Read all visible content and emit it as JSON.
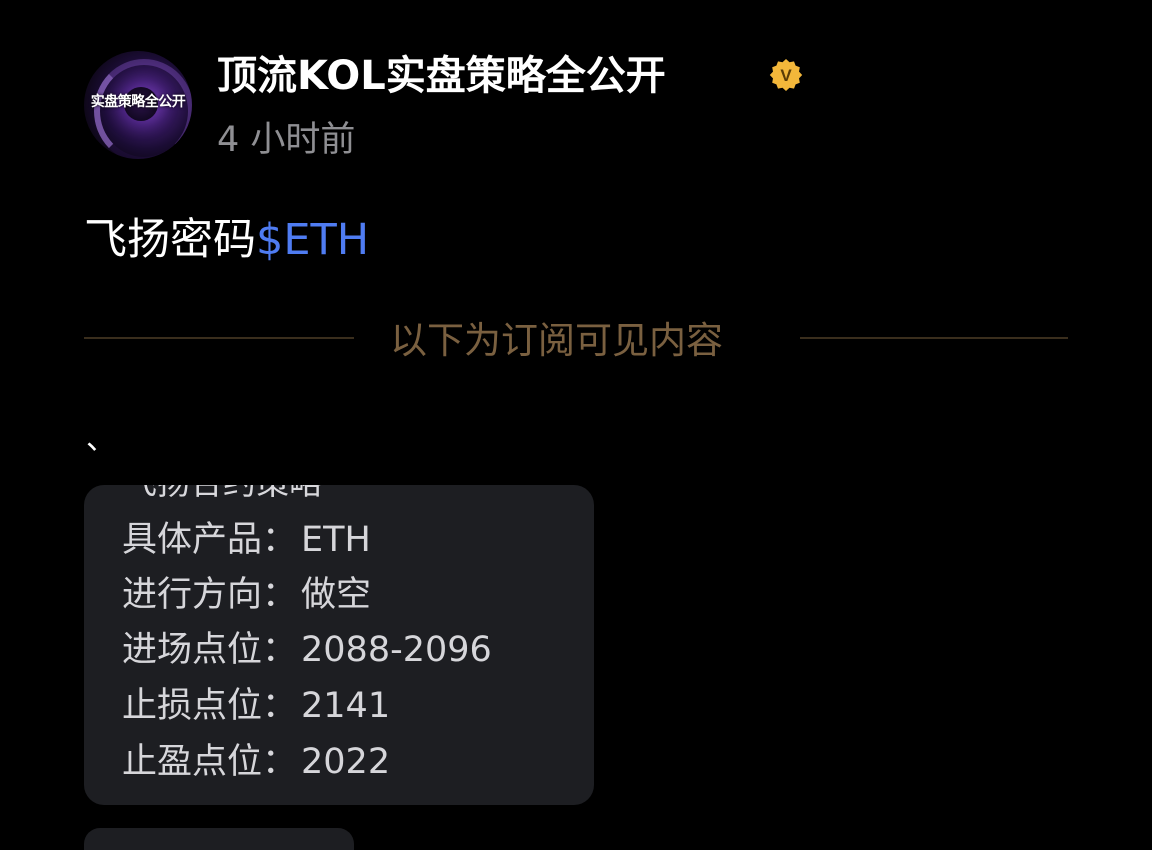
{
  "author": {
    "avatar_text": "实盘策略全公开",
    "name": "顶流KOL实盘策略全公开",
    "badge_letter": "V",
    "badge_color": "#f3b73a",
    "timestamp": "4 小时前"
  },
  "post": {
    "text": "飞扬密码",
    "tag": "$ETH",
    "tag_color": "#4f7cf2"
  },
  "divider": {
    "label": "以下为订阅可见内容"
  },
  "punct": "、",
  "card": {
    "title": "飞扬合约策略",
    "rows": [
      {
        "label": "具体产品：",
        "value": "ETH"
      },
      {
        "label": "进行方向：",
        "value": "做空"
      },
      {
        "label": "进场点位：",
        "value": "2088-2096"
      },
      {
        "label": "止损点位：",
        "value": "2141"
      },
      {
        "label": "止盈点位：",
        "value": "2022"
      }
    ]
  }
}
